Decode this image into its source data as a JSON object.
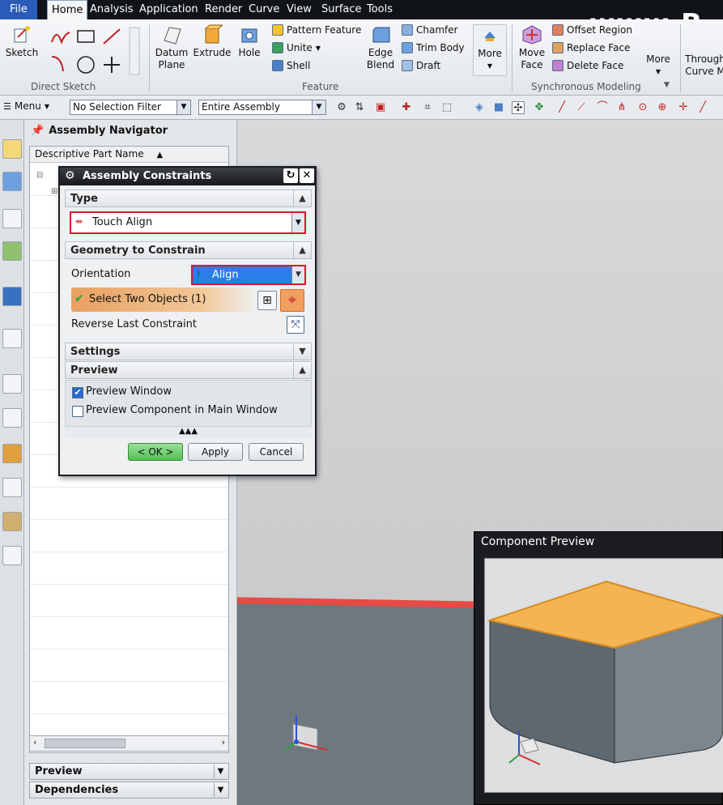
{
  "menubar": {
    "file": "File",
    "items": [
      "Home",
      "Analysis",
      "Application",
      "Render",
      "Curve",
      "View",
      "Surface",
      "Tools"
    ],
    "watermark": "www.B"
  },
  "ribbon": {
    "sketch": "Sketch",
    "direct_sketch": "Direct Sketch",
    "datum_plane": "Datum Plane",
    "extrude": "Extrude",
    "hole": "Hole",
    "pattern_feature": "Pattern Feature",
    "unite": "Unite",
    "shell": "Shell",
    "edge_blend": "Edge Blend",
    "chamfer": "Chamfer",
    "trim_body": "Trim Body",
    "draft": "Draft",
    "more": "More",
    "feature": "Feature",
    "move_face": "Move Face",
    "offset_region": "Offset Region",
    "replace_face": "Replace Face",
    "delete_face": "Delete Face",
    "more2": "More",
    "synchronous_modeling": "Synchronous Modeling",
    "through_curve": "Through Curve M"
  },
  "toolbar": {
    "menu": "Menu",
    "selection_filter": "No Selection Filter",
    "assembly_scope": "Entire Assembly"
  },
  "navigator": {
    "title": "Assembly Navigator",
    "column": "Descriptive Part Name",
    "preview": "Preview",
    "dependencies": "Dependencies"
  },
  "dialog": {
    "title": "Assembly Constraints",
    "type_label": "Type",
    "type_value": "Touch Align",
    "geometry_label": "Geometry to Constrain",
    "orientation_label": "Orientation",
    "orientation_value": "Align",
    "select_two": "Select Two Objects (1)",
    "reverse_last": "Reverse Last Constraint",
    "settings_label": "Settings",
    "preview_label": "Preview",
    "preview_window": "Preview Window",
    "preview_component": "Preview Component in Main Window",
    "ok": "< OK >",
    "apply": "Apply",
    "cancel": "Cancel"
  },
  "component_preview": {
    "title": "Component Preview"
  },
  "colors": {
    "accent_blue": "#2a5cb8",
    "highlight_red": "#e0142a",
    "face_orange": "#f5b453",
    "ok_green": "#52c152"
  }
}
